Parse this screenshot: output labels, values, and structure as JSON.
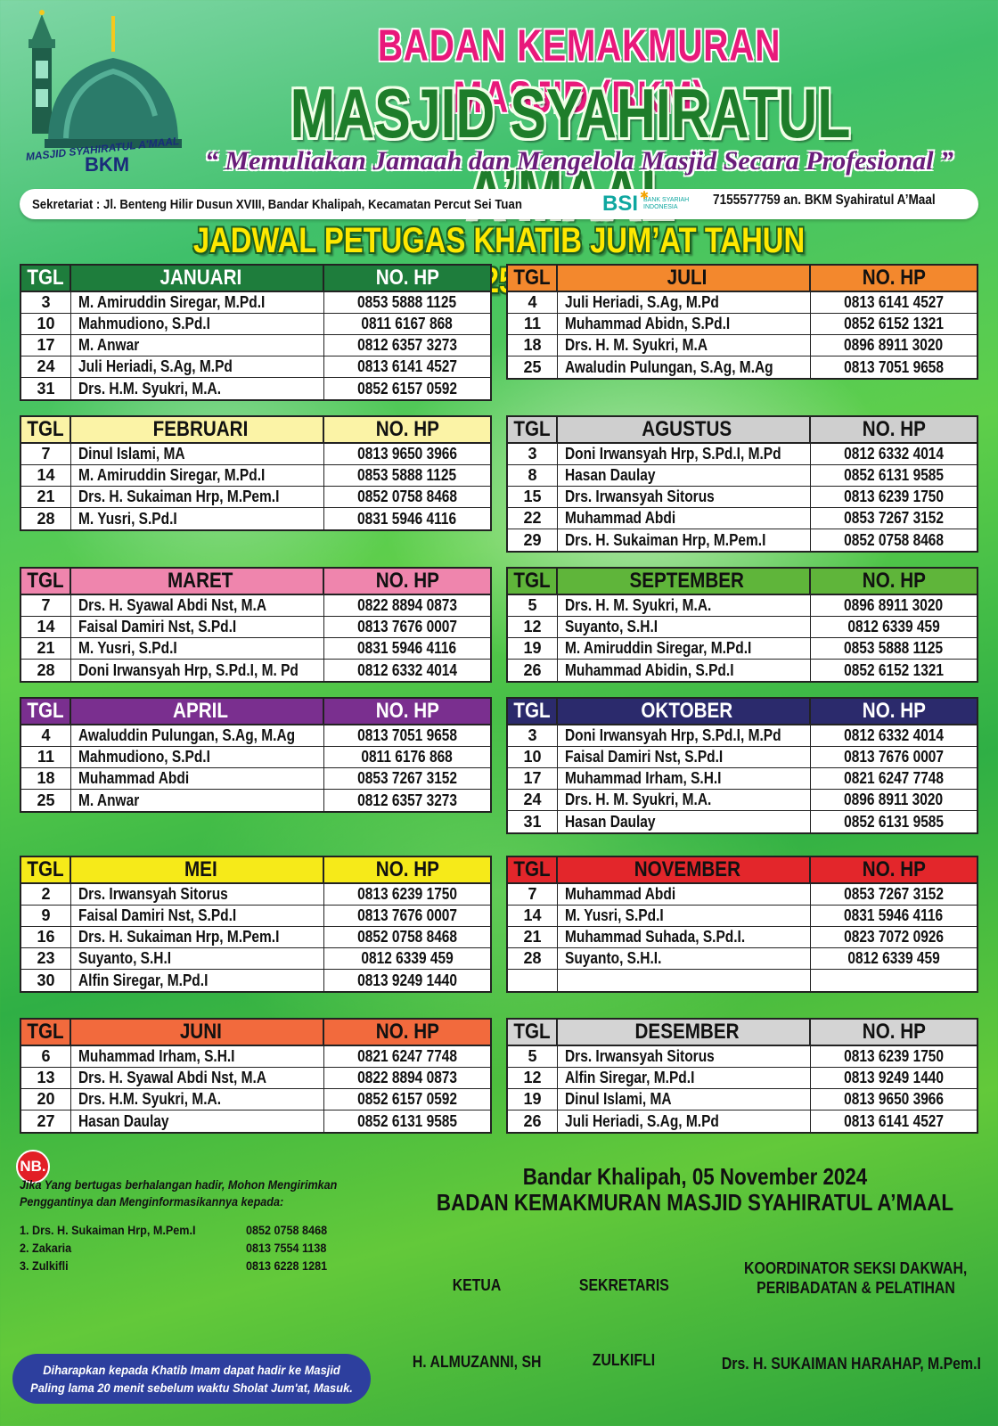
{
  "header": {
    "logo_text_top": "MASJID SYAHIRATUL A'MAAL",
    "logo_text_bottom": "BKM",
    "title_1": "BADAN KEMAKMURAN MASJID (BKM)",
    "title_2": "MASJID SYAHIRATUL A’MAAL",
    "tagline": "“ Memuliakan Jamaah dan Mengelola Masjid Secara Profesional ”",
    "sekretariat": "Sekretariat : Jl. Benteng Hilir Dusun XVIII, Bandar Khalipah, Kecamatan Percut Sei Tuan",
    "bank_logo": "BSI",
    "bank_logo_sub_1": "BANK SYARIAH",
    "bank_logo_sub_2": "INDONESIA",
    "account": "7155577759 an. BKM Syahiratul A’Maal",
    "schedule_title": "JADWAL PETUGAS KHATIB JUM’AT TAHUN 2025 M"
  },
  "col_labels": {
    "tgl": "TGL",
    "hp": "NO. HP"
  },
  "months": [
    {
      "name": "JANUARI",
      "color": "#1e7d3c",
      "text_color": "#ffffff",
      "tgl_color": "#1e7d3c",
      "hp_color": "#1e7d3c",
      "rows": [
        {
          "tgl": "3",
          "name": "M. Amiruddin Siregar, M.Pd.I",
          "hp": "0853 5888 1125"
        },
        {
          "tgl": "10",
          "name": "Mahmudiono, S.Pd.I",
          "hp": "0811 6167 868"
        },
        {
          "tgl": "17",
          "name": "M. Anwar",
          "hp": "0812 6357 3273"
        },
        {
          "tgl": "24",
          "name": "Juli Heriadi, S.Ag, M.Pd",
          "hp": "0813 6141 4527"
        },
        {
          "tgl": "31",
          "name": "Drs. H.M. Syukri, M.A.",
          "hp": "0852 6157 0592"
        }
      ]
    },
    {
      "name": "FEBRUARI",
      "color": "#fbf3a6",
      "text_color": "#111111",
      "tgl_color": "#fbf3a6",
      "hp_color": "#fbf3a6",
      "rows": [
        {
          "tgl": "7",
          "name": "Dinul Islami, MA",
          "hp": "0813 9650 3966"
        },
        {
          "tgl": "14",
          "name": "M. Amiruddin Siregar, M.Pd.I",
          "hp": "0853 5888 1125"
        },
        {
          "tgl": "21",
          "name": "Drs. H. Sukaiman Hrp, M.Pem.I",
          "hp": "0852 0758 8468"
        },
        {
          "tgl": "28",
          "name": "M. Yusri, S.Pd.I",
          "hp": "0831 5946 4116"
        }
      ]
    },
    {
      "name": "MARET",
      "color": "#ef85ad",
      "text_color": "#111111",
      "tgl_color": "#ef85ad",
      "hp_color": "#ef85ad",
      "rows": [
        {
          "tgl": "7",
          "name": "Drs. H. Syawal Abdi Nst, M.A",
          "hp": "0822 8894 0873"
        },
        {
          "tgl": "14",
          "name": "Faisal Damiri Nst, S.Pd.I",
          "hp": "0813 7676 0007"
        },
        {
          "tgl": "21",
          "name": "M. Yusri, S.Pd.I",
          "hp": "0831 5946 4116"
        },
        {
          "tgl": "28",
          "name": "Doni Irwansyah Hrp, S.Pd.I, M. Pd",
          "hp": "0812 6332 4014"
        }
      ]
    },
    {
      "name": "APRIL",
      "color": "#7a2f8f",
      "text_color": "#ffffff",
      "tgl_color": "#7a2f8f",
      "hp_color": "#7a2f8f",
      "rows": [
        {
          "tgl": "4",
          "name": "Awaluddin Pulungan, S.Ag, M.Ag",
          "hp": "0813 7051 9658"
        },
        {
          "tgl": "11",
          "name": "Mahmudiono, S.Pd.I",
          "hp": "0811 6176 868"
        },
        {
          "tgl": "18",
          "name": "Muhammad Abdi",
          "hp": "0853 7267 3152"
        },
        {
          "tgl": "25",
          "name": "M. Anwar",
          "hp": "0812 6357 3273"
        }
      ]
    },
    {
      "name": "MEI",
      "color": "#f6ea19",
      "text_color": "#111111",
      "tgl_color": "#f6ea19",
      "hp_color": "#f6ea19",
      "rows": [
        {
          "tgl": "2",
          "name": "Drs. Irwansyah Sitorus",
          "hp": "0813 6239 1750"
        },
        {
          "tgl": "9",
          "name": "Faisal Damiri Nst, S.Pd.I",
          "hp": "0813 7676 0007"
        },
        {
          "tgl": "16",
          "name": "Drs. H. Sukaiman Hrp, M.Pem.I",
          "hp": "0852 0758 8468"
        },
        {
          "tgl": "23",
          "name": "Suyanto, S.H.I",
          "hp": "0812 6339 459"
        },
        {
          "tgl": "30",
          "name": "Alfin Siregar, M.Pd.I",
          "hp": "0813 9249 1440"
        }
      ]
    },
    {
      "name": "JUNI",
      "color": "#f26a3d",
      "text_color": "#111111",
      "tgl_color": "#f26a3d",
      "hp_color": "#f26a3d",
      "rows": [
        {
          "tgl": "6",
          "name": "Muhammad Irham, S.H.I",
          "hp": "0821 6247 7748"
        },
        {
          "tgl": "13",
          "name": "Drs. H. Syawal Abdi Nst, M.A",
          "hp": "0822 8894 0873"
        },
        {
          "tgl": "20",
          "name": "Drs. H.M. Syukri, M.A.",
          "hp": "0852 6157 0592"
        },
        {
          "tgl": "27",
          "name": "Hasan Daulay",
          "hp": "0852 6131 9585"
        }
      ]
    },
    {
      "name": "JULI",
      "color": "#f3882d",
      "text_color": "#111111",
      "tgl_color": "#f3882d",
      "hp_color": "#f3882d",
      "rows": [
        {
          "tgl": "4",
          "name": "Juli Heriadi, S.Ag, M.Pd",
          "hp": "0813 6141 4527"
        },
        {
          "tgl": "11",
          "name": "Muhammad Abidn, S.Pd.I",
          "hp": "0852 6152 1321"
        },
        {
          "tgl": "18",
          "name": "Drs. H. M. Syukri, M.A",
          "hp": "0896 8911 3020"
        },
        {
          "tgl": "25",
          "name": "Awaludin Pulungan, S.Ag, M.Ag",
          "hp": "0813 7051 9658"
        }
      ]
    },
    {
      "name": "AGUSTUS",
      "color": "#cfcfcf",
      "text_color": "#111111",
      "tgl_color": "#cfcfcf",
      "hp_color": "#cfcfcf",
      "rows": [
        {
          "tgl": "3",
          "name": "Doni Irwansyah Hrp, S.Pd.I, M.Pd",
          "hp": "0812 6332 4014"
        },
        {
          "tgl": "8",
          "name": "Hasan Daulay",
          "hp": "0852 6131 9585"
        },
        {
          "tgl": "15",
          "name": "Drs. Irwansyah Sitorus",
          "hp": "0813 6239 1750"
        },
        {
          "tgl": "22",
          "name": "Muhammad Abdi",
          "hp": "0853 7267 3152"
        },
        {
          "tgl": "29",
          "name": "Drs. H. Sukaiman Hrp, M.Pem.I",
          "hp": "0852 0758 8468"
        }
      ]
    },
    {
      "name": "SEPTEMBER",
      "color": "#5fb53a",
      "text_color": "#111111",
      "tgl_color": "#5fb53a",
      "hp_color": "#5fb53a",
      "rows": [
        {
          "tgl": "5",
          "name": "Drs. H. M. Syukri, M.A.",
          "hp": "0896 8911 3020"
        },
        {
          "tgl": "12",
          "name": "Suyanto, S.H.I",
          "hp": "0812 6339 459"
        },
        {
          "tgl": "19",
          "name": "M. Amiruddin Siregar, M.Pd.I",
          "hp": "0853 5888 1125"
        },
        {
          "tgl": "26",
          "name": "Muhammad Abidin, S.Pd.I",
          "hp": "0852 6152 1321"
        }
      ]
    },
    {
      "name": "OKTOBER",
      "color": "#2b2a6c",
      "text_color": "#ffffff",
      "tgl_color": "#2b2a6c",
      "hp_color": "#2b2a6c",
      "rows": [
        {
          "tgl": "3",
          "name": "Doni Irwansyah Hrp, S.Pd.I, M.Pd",
          "hp": "0812 6332 4014"
        },
        {
          "tgl": "10",
          "name": "Faisal Damiri Nst, S.Pd.I",
          "hp": "0813 7676 0007"
        },
        {
          "tgl": "17",
          "name": "Muhammad Irham, S.H.I",
          "hp": "0821 6247 7748"
        },
        {
          "tgl": "24",
          "name": "Drs. H. M. Syukri, M.A.",
          "hp": "0896 8911 3020"
        },
        {
          "tgl": "31",
          "name": "Hasan Daulay",
          "hp": "0852 6131 9585"
        }
      ]
    },
    {
      "name": "NOVEMBER",
      "color": "#e3262b",
      "text_color": "#111111",
      "tgl_color": "#e3262b",
      "hp_color": "#e3262b",
      "rows": [
        {
          "tgl": "7",
          "name": "Muhammad Abdi",
          "hp": "0853 7267 3152"
        },
        {
          "tgl": "14",
          "name": "M. Yusri, S.Pd.I",
          "hp": "0831 5946 4116"
        },
        {
          "tgl": "21",
          "name": "Muhammad Suhada, S.Pd.I.",
          "hp": "0823 7072 0926"
        },
        {
          "tgl": "28",
          "name": "Suyanto, S.H.I.",
          "hp": "0812 6339 459"
        },
        {
          "tgl": "",
          "name": "",
          "hp": ""
        }
      ]
    },
    {
      "name": "DESEMBER",
      "color": "#d4d4d4",
      "text_color": "#111111",
      "tgl_color": "#d4d4d4",
      "hp_color": "#d4d4d4",
      "rows": [
        {
          "tgl": "5",
          "name": "Drs. Irwansyah Sitorus",
          "hp": "0813 6239 1750"
        },
        {
          "tgl": "12",
          "name": "Alfin Siregar, M.Pd.I",
          "hp": "0813 9249 1440"
        },
        {
          "tgl": "19",
          "name": "Dinul Islami, MA",
          "hp": "0813 9650 3966"
        },
        {
          "tgl": "26",
          "name": "Juli Heriadi, S.Ag, M.Pd",
          "hp": "0813 6141 4527"
        }
      ]
    }
  ],
  "footer": {
    "nb_label": "NB.",
    "nb_line_1": "Jika Yang bertugas berhalangan hadir, Mohon Mengirimkan",
    "nb_line_2": "Penggantinya dan Menginformasikannya kepada:",
    "contacts": [
      {
        "name": "1. Drs. H. Sukaiman Hrp, M.Pem.I",
        "phone": "0852 0758 8468"
      },
      {
        "name": "2. Zakaria",
        "phone": "0813 7554 1138"
      },
      {
        "name": "3. Zulkifli",
        "phone": "0813 6228 1281"
      }
    ],
    "reminder_line_1": "Diharapkan kepada Khatib Imam dapat hadir ke Masjid",
    "reminder_line_2": "Paling lama 20 menit sebelum waktu Sholat Jum'at, Masuk.",
    "place_date": "Bandar Khalipah, 05 November 2024",
    "org": "BADAN KEMAKMURAN MASJID SYAHIRATUL A’MAAL",
    "ketua_title": "KETUA",
    "sekretaris_title": "SEKRETARIS",
    "koordinator_title_1": "KOORDINATOR SEKSI DAKWAH,",
    "koordinator_title_2": "PERIBADATAN & PELATIHAN",
    "ketua_name": "H. ALMUZANNI, SH",
    "sekretaris_name": "ZULKIFLI",
    "koordinator_name": "Drs. H. SUKAIMAN HARAHAP, M.Pem.I"
  }
}
